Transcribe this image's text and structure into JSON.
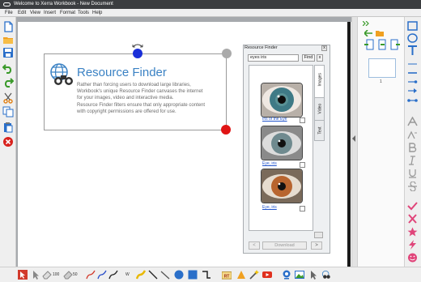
{
  "window": {
    "title": "Welcome to Xerra Workbook - New Document"
  },
  "menu": [
    "File",
    "Edit",
    "View",
    "Insert",
    "Format",
    "Tools",
    "Help"
  ],
  "card": {
    "title": "Resource Finder",
    "body_lines": [
      "Rather than forcing users to download large libraries,",
      "Workbook's unique Resource Finder canvases the internet",
      "for your images, video and interactive media.",
      "Resource Finder filters ensure that only appropriate content",
      "with copyright permissions are offered for use."
    ]
  },
  "resource_finder": {
    "title": "Resource Finder",
    "close_label": "x",
    "search_value": "eyes iris",
    "find_label": "Find",
    "clear_label": "x",
    "tabs": [
      "Images",
      "Video",
      "Text"
    ],
    "results": [
      {
        "caption": "Iris of the Eye",
        "iris_color": "#3f7a86"
      },
      {
        "caption": "Eye, iris",
        "iris_color": "#6f8a8f"
      },
      {
        "caption": "Eye, iris",
        "iris_color": "#b8652f"
      }
    ],
    "prev_label": "<",
    "download_label": "Download",
    "next_label": ">"
  },
  "pages_panel": {
    "page_number": "1"
  },
  "bottom_toolbar": {
    "size_small": "100",
    "size_large": "50",
    "pen_label": "W"
  },
  "colors": {
    "accent": "#3b82c4",
    "handle_top": "#1a2fd8",
    "handle_corner": "#aaaaaa",
    "handle_bottom": "#e01414",
    "title_bar": "#3b3d40"
  }
}
